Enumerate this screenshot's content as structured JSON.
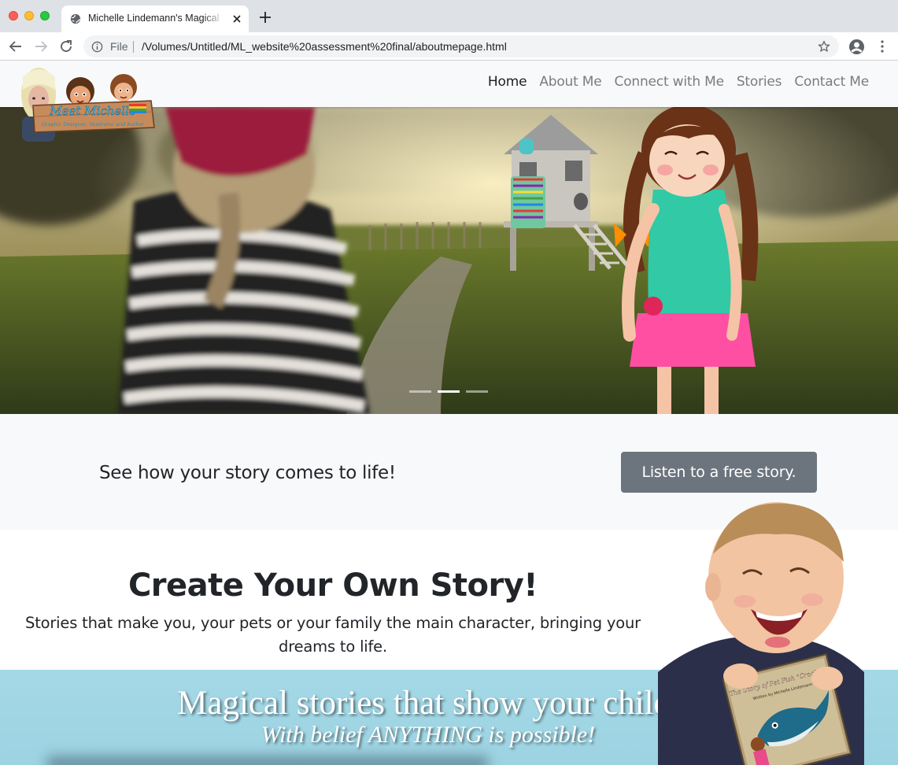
{
  "browser": {
    "tab_title": "Michelle Lindemann's Magical Stories",
    "url_scheme_label": "File",
    "url": "/Volumes/Untitled/ML_website%20assessment%20final/aboutmepage.html"
  },
  "logo": {
    "text_main": "Meet Michelle",
    "text_sub": "Graphic Designer, Illustrator and Author"
  },
  "nav": {
    "items": [
      {
        "label": "Home",
        "active": true
      },
      {
        "label": "About Me",
        "active": false
      },
      {
        "label": "Connect with Me",
        "active": false
      },
      {
        "label": "Stories",
        "active": false
      },
      {
        "label": "Contact Me",
        "active": false
      }
    ]
  },
  "carousel": {
    "slide_count": 3,
    "active_index": 1
  },
  "cta": {
    "text": "See how your story comes to life!",
    "button_label": "Listen to a free story."
  },
  "create": {
    "heading": "Create Your Own Story!",
    "text": "Stories that make you, your pets or your family the main character, bringing your dreams to life."
  },
  "banner": {
    "line1": "Magical stories that show your child,",
    "line2": "With belief ANYTHING is possible!"
  },
  "book": {
    "title": "The Story of Pet Fish \"Croaked!\"",
    "author": "Written by Michelle Lindemann"
  },
  "colors": {
    "nav_bg": "#f8f9fa",
    "cta_button_bg": "#6c757d",
    "banner_bg": "#a4d8e6",
    "tab_strip_bg": "#dee1e6"
  }
}
